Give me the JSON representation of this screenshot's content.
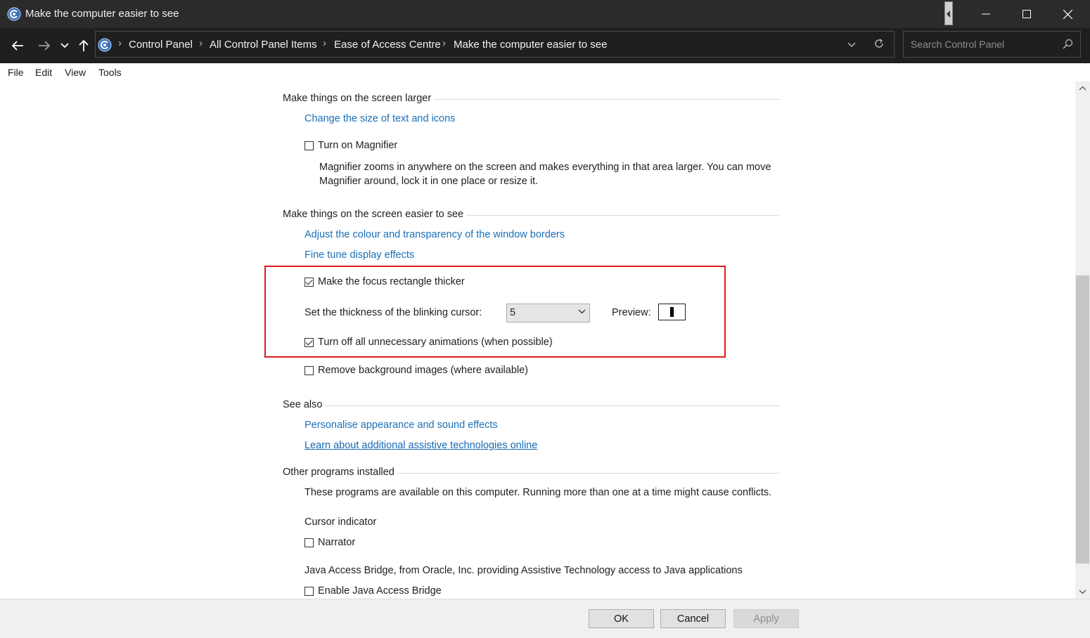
{
  "window": {
    "title": "Make the computer easier to see",
    "controls": [
      "minimize-icon",
      "maximize-icon",
      "close-icon"
    ]
  },
  "nav": {
    "breadcrumbs": [
      "Control Panel",
      "All Control Panel Items",
      "Ease of Access Centre",
      "Make the computer easier to see"
    ],
    "search_placeholder": "Search Control Panel"
  },
  "menu": {
    "items": [
      "File",
      "Edit",
      "View",
      "Tools"
    ]
  },
  "sections": {
    "larger": {
      "title": "Make things on the screen larger",
      "link_text_size": "Change the size of text and icons",
      "magnifier_label": "Turn on Magnifier",
      "magnifier_checked": false,
      "magnifier_desc": "Magnifier zooms in anywhere on the screen and makes everything in that area larger. You can move Magnifier around, lock it in one place or resize it."
    },
    "easier": {
      "title": "Make things on the screen easier to see",
      "link_colour": "Adjust the colour and transparency of the window borders",
      "link_fine_tune": "Fine tune display effects",
      "focus_label": "Make the focus rectangle thicker",
      "focus_checked": true,
      "cursor_label": "Set the thickness of the blinking cursor:",
      "cursor_value": "5",
      "preview_label": "Preview:",
      "animations_label": "Turn off all unnecessary animations (when possible)",
      "animations_checked": true,
      "background_label": "Remove background images (where available)",
      "background_checked": false
    },
    "see_also": {
      "title": "See also",
      "link_personalise": "Personalise appearance and sound effects",
      "link_learn": "Learn about additional assistive technologies online"
    },
    "other": {
      "title": "Other programs installed",
      "intro": "These programs are available on this computer. Running more than one at a time might cause conflicts.",
      "cursor_indicator": "Cursor indicator",
      "narrator_label": "Narrator",
      "narrator_checked": false,
      "java_desc": "Java Access Bridge, from Oracle, Inc. providing Assistive Technology access to Java applications",
      "java_label": "Enable Java Access Bridge",
      "java_checked": false
    }
  },
  "footer": {
    "ok": "OK",
    "cancel": "Cancel",
    "apply": "Apply",
    "apply_enabled": false
  },
  "colors": {
    "titlebar": "#2b2b2b",
    "navbar": "#1f1f1f",
    "link": "#1a6fb8",
    "highlight_border": "#e01b1b"
  }
}
